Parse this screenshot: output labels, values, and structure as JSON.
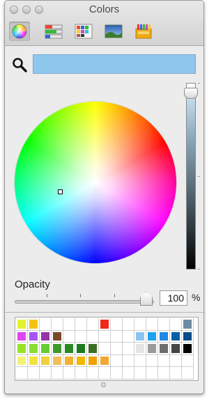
{
  "window": {
    "title": "Colors"
  },
  "toolbar": {
    "tools": [
      {
        "id": "color-wheel",
        "icon": "color-wheel-icon",
        "selected": true
      },
      {
        "id": "sliders",
        "icon": "sliders-icon",
        "selected": false
      },
      {
        "id": "palettes",
        "icon": "palettes-icon",
        "selected": false
      },
      {
        "id": "image",
        "icon": "image-palette-icon",
        "selected": false
      },
      {
        "id": "crayons",
        "icon": "crayons-icon",
        "selected": false
      }
    ]
  },
  "search": {
    "value": "",
    "color": "#8fc6ee"
  },
  "wheel": {
    "brightness": 0.97
  },
  "opacity": {
    "label": "Opacity",
    "value": "100",
    "unit": "%"
  },
  "swatches": {
    "columns": 15,
    "rows": 5,
    "colors": [
      [
        "#e3f230",
        "#f2c40f",
        null,
        null,
        null,
        null,
        null,
        "#f0281a",
        null,
        null,
        null,
        null,
        null,
        null,
        "#6f8ca2"
      ],
      [
        "#e044f0",
        "#a555f0",
        "#9933aa",
        "#7a4a2a",
        null,
        null,
        null,
        null,
        null,
        null,
        "#8ac4f2",
        "#1ca2f0",
        "#1e88e4",
        "#0a5fa8",
        "#0a4c88"
      ],
      [
        "#9ae228",
        "#88dd33",
        "#66cc33",
        "#3a9a2a",
        "#2a8822",
        "#1e7a1e",
        "#3e6e24",
        null,
        null,
        null,
        "#e4e4e4",
        "#9a9a9a",
        "#6e6e6e",
        "#454545",
        "#000000"
      ],
      [
        "#f2f27a",
        "#f2e23e",
        "#f0d040",
        "#f0bf5a",
        "#f0b030",
        "#f0b800",
        "#f0a000",
        "#f0a833",
        null,
        null,
        null,
        null,
        null,
        null,
        null
      ],
      [
        null,
        null,
        null,
        null,
        null,
        null,
        null,
        null,
        null,
        null,
        null,
        null,
        null,
        null,
        null
      ]
    ]
  }
}
